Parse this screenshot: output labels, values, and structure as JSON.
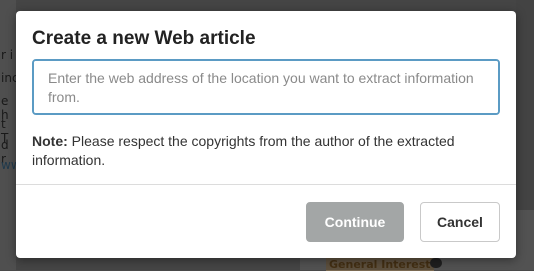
{
  "background": {
    "left_fragments": [
      "r i",
      "inc",
      "e h",
      "t T",
      "d r",
      "ww"
    ],
    "tag_label": "General Interest"
  },
  "modal": {
    "title": "Create a new Web article",
    "url_input": {
      "value": "",
      "placeholder": "Enter the web address of the location you want to extract information from."
    },
    "note_label": "Note:",
    "note_text": " Please respect the copyrights from the author of the extracted information.",
    "continue_label": "Continue",
    "cancel_label": "Cancel"
  },
  "colors": {
    "accent_border": "#5b9bc4",
    "continue_disabled_bg": "#a3a6a6"
  }
}
